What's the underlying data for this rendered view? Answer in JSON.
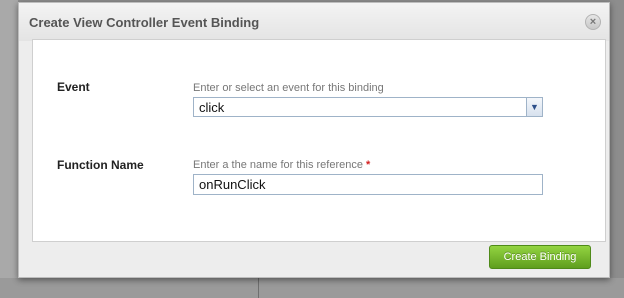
{
  "dialog": {
    "title": "Create View Controller Event Binding",
    "close_symbol": "×"
  },
  "event": {
    "label": "Event",
    "hint": "Enter or select an event for this binding",
    "selected_value": "click",
    "dropdown_icon": "chevron-down-icon"
  },
  "function_name": {
    "label": "Function Name",
    "hint": "Enter a the name for this reference",
    "required_marker": "*",
    "value": "onRunClick"
  },
  "footer": {
    "create_button_label": "Create Binding"
  },
  "colors": {
    "create_button": "#6fb22b",
    "required_marker": "#d42020"
  }
}
